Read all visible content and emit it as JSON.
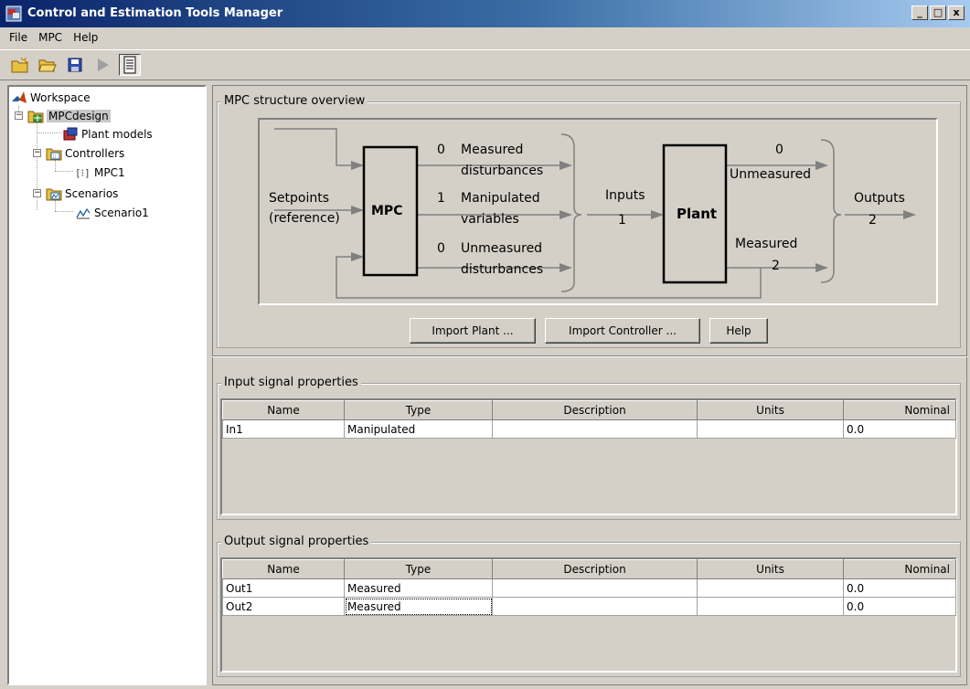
{
  "window": {
    "title": "Control and Estimation Tools Manager",
    "buttons": [
      "_",
      "□",
      "x"
    ]
  },
  "menu": [
    "File",
    "MPC",
    "Help"
  ],
  "toolbar": {
    "icons": [
      "new-project-icon",
      "open-folder-icon",
      "save-icon",
      "run-icon",
      "notes-icon"
    ]
  },
  "tree": {
    "workspace": "Workspace",
    "project": "MPCdesign",
    "plant_models": "Plant models",
    "controllers": "Controllers",
    "controller_1": "MPC1",
    "scenarios": "Scenarios",
    "scenario_1": "Scenario1"
  },
  "overview": {
    "title": "MPC structure overview",
    "setpoints": "Setpoints",
    "reference": "(reference)",
    "mpc_block": "MPC",
    "plant_block": "Plant",
    "md_count": "0",
    "md_label_1": "Measured",
    "md_label_2": "disturbances",
    "mv_count": "1",
    "mv_label_1": "Manipulated",
    "mv_label_2": "variables",
    "ud_count": "0",
    "ud_label_1": "Unmeasured",
    "ud_label_2": "disturbances",
    "inputs_label": "Inputs",
    "inputs_count": "1",
    "unmeasured_count": "0",
    "unmeasured_label": "Unmeasured",
    "measured_label": "Measured",
    "measured_count": "2",
    "outputs_label": "Outputs",
    "outputs_count": "2"
  },
  "buttons": {
    "import_plant": "Import Plant ...",
    "import_controller": "Import Controller ...",
    "help": "Help"
  },
  "input_props": {
    "title": "Input signal properties",
    "columns": [
      "Name",
      "Type",
      "Description",
      "Units",
      "Nominal"
    ],
    "rows": [
      [
        "In1",
        "Manipulated",
        "",
        "",
        "0.0"
      ]
    ]
  },
  "output_props": {
    "title": "Output signal properties",
    "columns": [
      "Name",
      "Type",
      "Description",
      "Units",
      "Nominal"
    ],
    "rows": [
      [
        "Out1",
        "Measured",
        "",
        "",
        "0.0"
      ],
      [
        "Out2",
        "Measured",
        "",
        "",
        "0.0"
      ]
    ]
  }
}
